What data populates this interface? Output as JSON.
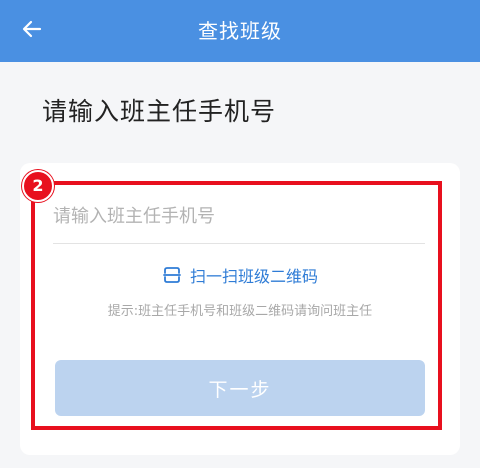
{
  "header": {
    "title": "查找班级",
    "back_icon": "back-arrow-icon"
  },
  "page": {
    "heading": "请输入班主任手机号"
  },
  "form": {
    "phone_placeholder": "请输入班主任手机号",
    "phone_value": "",
    "scan_label": "扫一扫班级二维码",
    "scan_icon": "scan-qr-icon",
    "hint": "提示:班主任手机号和班级二维码请询问班主任",
    "next_label": "下一步"
  },
  "annotation": {
    "step_number": "2",
    "color": "#e8101e"
  },
  "colors": {
    "header_bg": "#4a90e2",
    "link": "#2f7cd6",
    "button_disabled": "#bcd3ef"
  }
}
